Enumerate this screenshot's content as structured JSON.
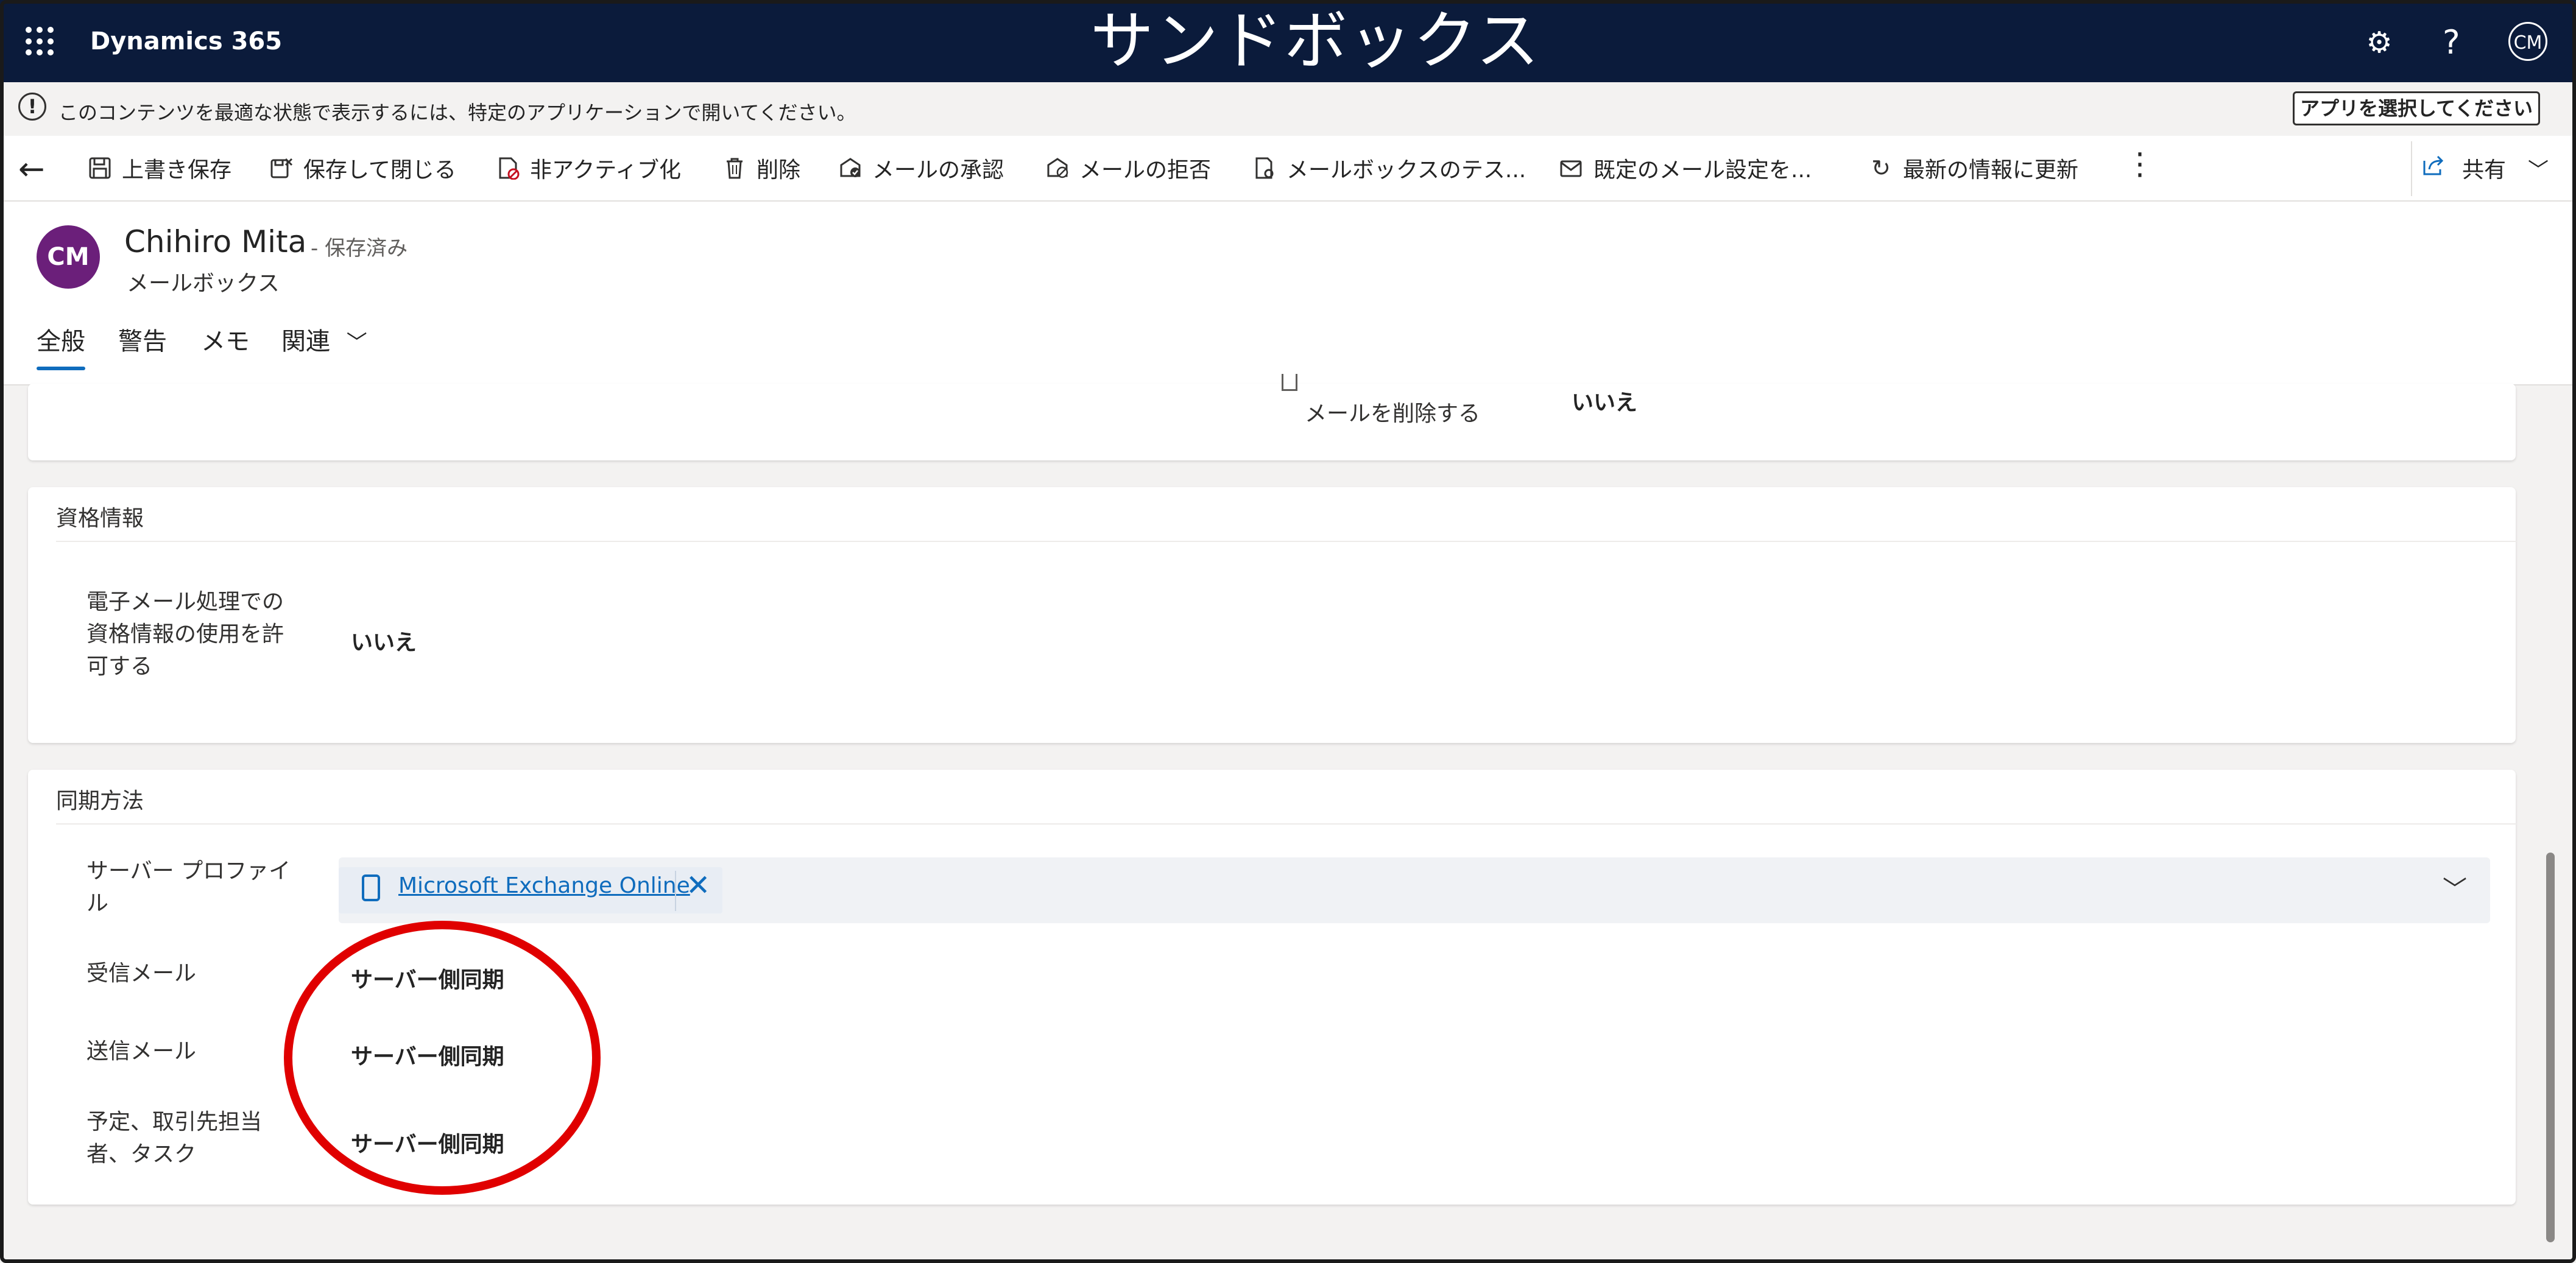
{
  "topbar": {
    "app_name": "Dynamics 365",
    "environment_label": "サンドボックス",
    "help_symbol": "?",
    "user_initials": "CM"
  },
  "notification": {
    "text": "このコンテンツを最適な状態で表示するには、特定のアプリケーションで開いてください。",
    "button": "アプリを選択してください"
  },
  "commands": {
    "save": "上書き保存",
    "save_close": "保存して閉じる",
    "deactivate": "非アクティブ化",
    "delete": "削除",
    "approve_email": "メールの承認",
    "reject_email": "メールの拒否",
    "test_mailbox": "メールボックスのテス...",
    "default_mail_settings": "既定のメール設定を...",
    "refresh": "最新の情報に更新",
    "share": "共有"
  },
  "record": {
    "initials": "CM",
    "name": "Chihiro Mita",
    "status": "- 保存済み",
    "entity": "メールボックス"
  },
  "tabs": [
    "全般",
    "警告",
    "メモ",
    "関連"
  ],
  "partial_section": {
    "label_line2": "メールを削除する",
    "value": "いいえ"
  },
  "credentials_section": {
    "title": "資格情報",
    "label_lines": [
      "電子メール処理での",
      "資格情報の使用を許",
      "可する"
    ],
    "value": "いいえ"
  },
  "sync_section": {
    "title": "同期方法",
    "server_profile": {
      "label_lines": [
        "サーバー プロファイ",
        "ル"
      ],
      "value": "Microsoft Exchange Online"
    },
    "incoming": {
      "label": "受信メール",
      "value": "サーバー側同期"
    },
    "outgoing": {
      "label": "送信メール",
      "value": "サーバー側同期"
    },
    "appointments": {
      "label_lines": [
        "予定、取引先担当",
        "者、タスク"
      ],
      "value": "サーバー側同期"
    }
  },
  "highlight_color": "#e00000"
}
